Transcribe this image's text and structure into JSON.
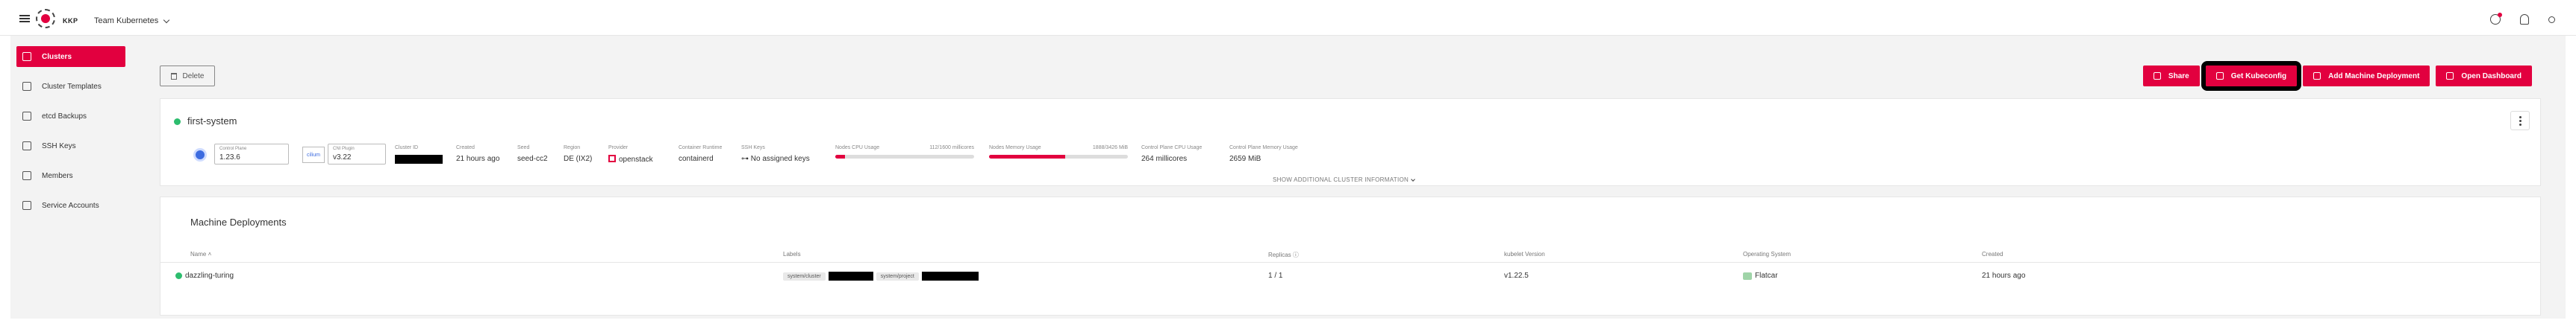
{
  "topbar": {
    "logo_text": "KKP",
    "project_name": "Team Kubernetes"
  },
  "sidebar": {
    "items": [
      {
        "label": "Clusters",
        "icon": "cluster-icon",
        "active": true
      },
      {
        "label": "Cluster Templates",
        "icon": "template-icon",
        "active": false
      },
      {
        "label": "etcd Backups",
        "icon": "backup-icon",
        "active": false
      },
      {
        "label": "SSH Keys",
        "icon": "key-icon",
        "active": false
      },
      {
        "label": "Members",
        "icon": "members-icon",
        "active": false
      },
      {
        "label": "Service Accounts",
        "icon": "service-account-icon",
        "active": false
      }
    ]
  },
  "toolbar": {
    "delete_label": "Delete",
    "share_label": "Share",
    "kubeconfig_label": "Get Kubeconfig",
    "add_md_label": "Add Machine Deployment",
    "dashboard_label": "Open Dashboard"
  },
  "cluster": {
    "name": "first-system",
    "control_plane_label": "Control Plane",
    "control_plane_value": "1.23.6",
    "cni_label": "CNI Plugin",
    "cni_value": "v3.22",
    "cni_logo_text": "cilium",
    "cluster_id_label": "Cluster ID",
    "created_label": "Created",
    "created_value": "21 hours ago",
    "seed_label": "Seed",
    "seed_value": "seed-cc2",
    "region_label": "Region",
    "region_value": "DE (IX2)",
    "provider_label": "Provider",
    "provider_value": "openstack",
    "runtime_label": "Container Runtime",
    "runtime_value": "containerd",
    "ssh_label": "SSH Keys",
    "ssh_value": "No assigned keys",
    "cpu_label": "Nodes CPU Usage",
    "cpu_value": "112/1600 millicores",
    "cpu_fraction": 0.07,
    "mem_label": "Nodes Memory Usage",
    "mem_value": "1888/3426 MiB",
    "mem_fraction": 0.55,
    "cp_cpu_label": "Control Plane CPU Usage",
    "cp_cpu_value": "264 millicores",
    "cp_mem_label": "Control Plane Memory Usage",
    "cp_mem_value": "2659 MiB",
    "show_more": "SHOW ADDITIONAL CLUSTER INFORMATION"
  },
  "machine_deployments": {
    "title": "Machine Deployments",
    "columns": [
      "Name",
      "Labels",
      "Replicas",
      "kubelet Version",
      "Operating System",
      "Created"
    ],
    "rows": [
      {
        "name": "dazzling-turing",
        "label1": "system/cluster",
        "label2": "system/project",
        "replicas": "1 / 1",
        "kubelet": "v1.22.5",
        "os": "Flatcar",
        "created": "21 hours ago"
      }
    ]
  }
}
